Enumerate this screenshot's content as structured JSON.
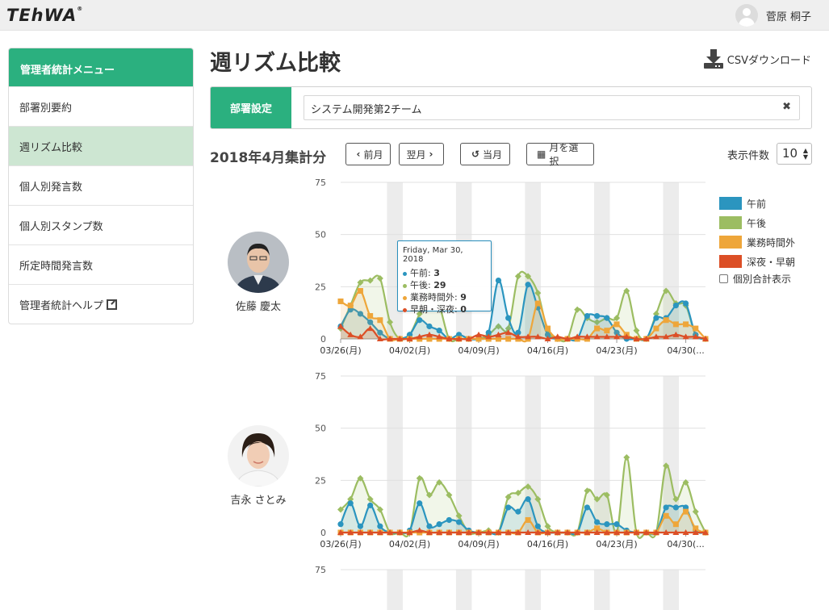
{
  "app": {
    "logo": "TEhWA",
    "logo_mark": "®"
  },
  "header": {
    "user_name": "菅原 桐子"
  },
  "sidebar": {
    "title": "管理者統計メニュー",
    "items": [
      {
        "label": "部署別要約"
      },
      {
        "label": "週リズム比較"
      },
      {
        "label": "個人別発言数"
      },
      {
        "label": "個人別スタンプ数"
      },
      {
        "label": "所定時間発言数"
      },
      {
        "label": "管理者統計ヘルプ"
      }
    ],
    "active_index": 1
  },
  "main": {
    "title": "週リズム比較",
    "csv_label": "CSVダウンロード",
    "dept_label": "部署設定",
    "dept_value": "システム開発第2チーム",
    "dept_clear": "✖",
    "period_title": "2018年4月集計分",
    "prev_label": "前月",
    "next_label": "翌月",
    "current_label": "当月",
    "select_label": "月を選択",
    "per_page_label": "表示件数",
    "per_page_value": "10"
  },
  "colors": {
    "am": "#2b95bf",
    "pm": "#9cbd62",
    "overtime": "#eea63a",
    "night": "#dc4f26",
    "brand": "#2bb07f"
  },
  "legend": {
    "items": [
      {
        "label": "午前",
        "color": "#2b95bf"
      },
      {
        "label": "午後",
        "color": "#9cbd62"
      },
      {
        "label": "業務時間外",
        "color": "#eea63a"
      },
      {
        "label": "深夜・早朝",
        "color": "#dc4f26"
      }
    ],
    "checkbox_label": "個別合計表示"
  },
  "tooltip": {
    "title": "Friday, Mar 30, 2018",
    "rows": [
      {
        "label": "午前",
        "value": "3"
      },
      {
        "label": "午後",
        "value": "29"
      },
      {
        "label": "業務時間外",
        "value": "9"
      },
      {
        "label": "早朝・深夜",
        "value": "0"
      }
    ]
  },
  "chart_data": [
    {
      "type": "area",
      "person": "佐藤 慶太",
      "x_tick_labels": [
        "03/26(月)",
        "04/02(月)",
        "04/09(月)",
        "04/16(月)",
        "04/23(月)",
        "04/30(..."
      ],
      "y_ticks": [
        0,
        25,
        50,
        75
      ],
      "ylim": [
        0,
        75
      ],
      "days": 38,
      "series": [
        {
          "name": "午前",
          "values": [
            6,
            14,
            12,
            8,
            3,
            0,
            0,
            2,
            9,
            6,
            4,
            0,
            2,
            0,
            0,
            3,
            28,
            10,
            3,
            26,
            15,
            2,
            0,
            0,
            0,
            11,
            11,
            10,
            3,
            0,
            0,
            0,
            10,
            10,
            16,
            17,
            2,
            0
          ]
        },
        {
          "name": "午後",
          "values": [
            5,
            16,
            27,
            28,
            29,
            8,
            0,
            2,
            12,
            22,
            16,
            0,
            0,
            0,
            0,
            2,
            6,
            5,
            30,
            30,
            22,
            4,
            0,
            0,
            14,
            10,
            8,
            10,
            10,
            23,
            4,
            0,
            12,
            23,
            17,
            16,
            2,
            0
          ]
        },
        {
          "name": "業務時間外",
          "values": [
            18,
            16,
            23,
            11,
            9,
            0,
            0,
            0,
            0,
            0,
            0,
            0,
            0,
            0,
            0,
            0,
            0,
            0,
            0,
            0,
            17,
            5,
            0,
            0,
            0,
            0,
            5,
            4,
            7,
            2,
            0,
            0,
            5,
            9,
            7,
            7,
            5,
            0
          ]
        },
        {
          "name": "深夜・早朝",
          "values": [
            6,
            2,
            1,
            5,
            0,
            0,
            0,
            0,
            1,
            2,
            1,
            0,
            0,
            0,
            2,
            1,
            2,
            3,
            1,
            1,
            1,
            0,
            1,
            0,
            1,
            1,
            1,
            1,
            1,
            1,
            0,
            0,
            1,
            1,
            2,
            1,
            1,
            0
          ]
        }
      ],
      "weekend_bands": [
        5,
        12,
        19,
        26,
        33
      ]
    },
    {
      "type": "area",
      "person": "吉永 さとみ",
      "x_tick_labels": [
        "03/26(月)",
        "04/02(月)",
        "04/09(月)",
        "04/16(月)",
        "04/23(月)",
        "04/30(..."
      ],
      "y_ticks": [
        0,
        25,
        50,
        75
      ],
      "ylim": [
        0,
        75
      ],
      "days": 38,
      "series": [
        {
          "name": "午前",
          "values": [
            4,
            14,
            3,
            13,
            3,
            0,
            0,
            1,
            14,
            3,
            4,
            6,
            5,
            1,
            0,
            0,
            0,
            12,
            10,
            16,
            3,
            0,
            0,
            0,
            0,
            12,
            5,
            4,
            4,
            1,
            0,
            0,
            0,
            12,
            12,
            12,
            1,
            0
          ]
        },
        {
          "name": "午後",
          "values": [
            11,
            16,
            26,
            16,
            11,
            0,
            0,
            0,
            26,
            18,
            24,
            18,
            8,
            0,
            0,
            1,
            0,
            17,
            19,
            22,
            16,
            3,
            0,
            0,
            0,
            20,
            16,
            18,
            0,
            36,
            0,
            0,
            0,
            32,
            16,
            24,
            10,
            0
          ]
        },
        {
          "name": "業務時間外",
          "values": [
            0,
            0,
            0,
            0,
            0,
            0,
            0,
            0,
            0,
            0,
            0,
            0,
            0,
            0,
            0,
            0,
            0,
            0,
            0,
            6,
            0,
            0,
            0,
            0,
            0,
            0,
            2,
            0,
            0,
            0,
            0,
            0,
            0,
            8,
            4,
            10,
            2,
            0
          ]
        },
        {
          "name": "深夜・早朝",
          "values": [
            0,
            0,
            0,
            0,
            0,
            0,
            0,
            0,
            1,
            0,
            0,
            0,
            0,
            0,
            0,
            0,
            0,
            0,
            0,
            0,
            0,
            0,
            0,
            0,
            0,
            0,
            0,
            0,
            0,
            0,
            0,
            0,
            0,
            0,
            0,
            0,
            0,
            0
          ]
        }
      ],
      "weekend_bands": [
        5,
        12,
        19,
        26,
        33
      ]
    }
  ],
  "third_chart": {
    "y_top_label": "75"
  }
}
